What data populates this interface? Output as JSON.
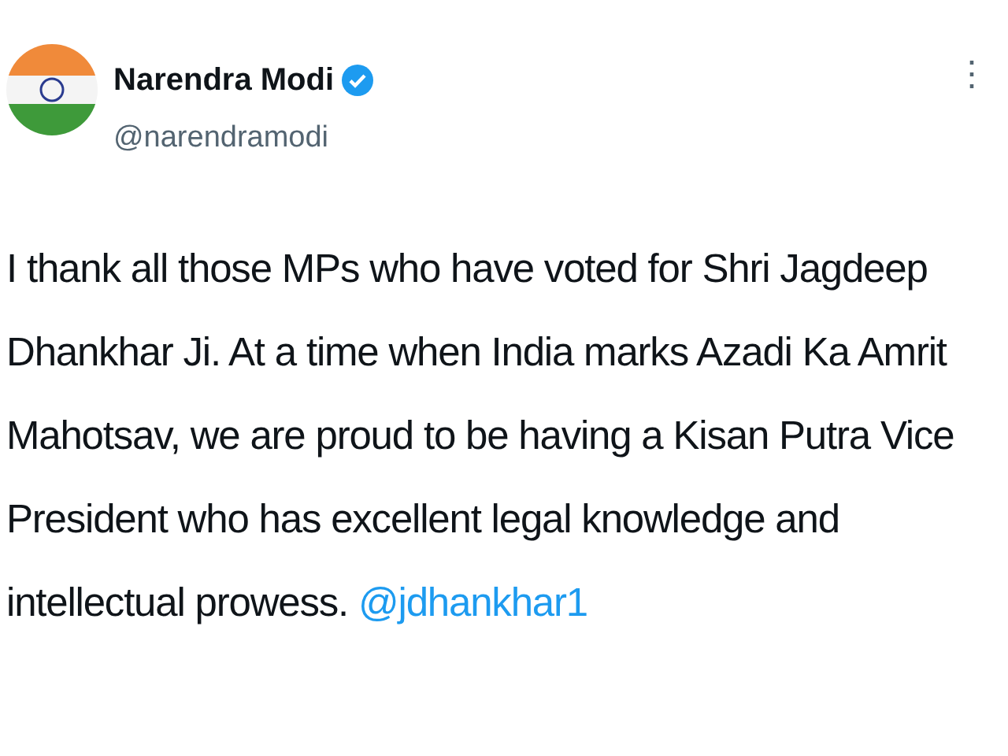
{
  "author": {
    "name": "Narendra Modi",
    "verified": true,
    "handle": "@narendramodi"
  },
  "more_button": "⋮",
  "tweet": {
    "text": "I thank all those MPs who have voted for Shri Jagdeep Dhankhar Ji. At a time when India marks Azadi Ka Amrit Mahotsav, we are proud to be having a Kisan Putra Vice President who has excellent legal knowledge and intellectual prowess.",
    "mention": "@jdhankhar1"
  }
}
